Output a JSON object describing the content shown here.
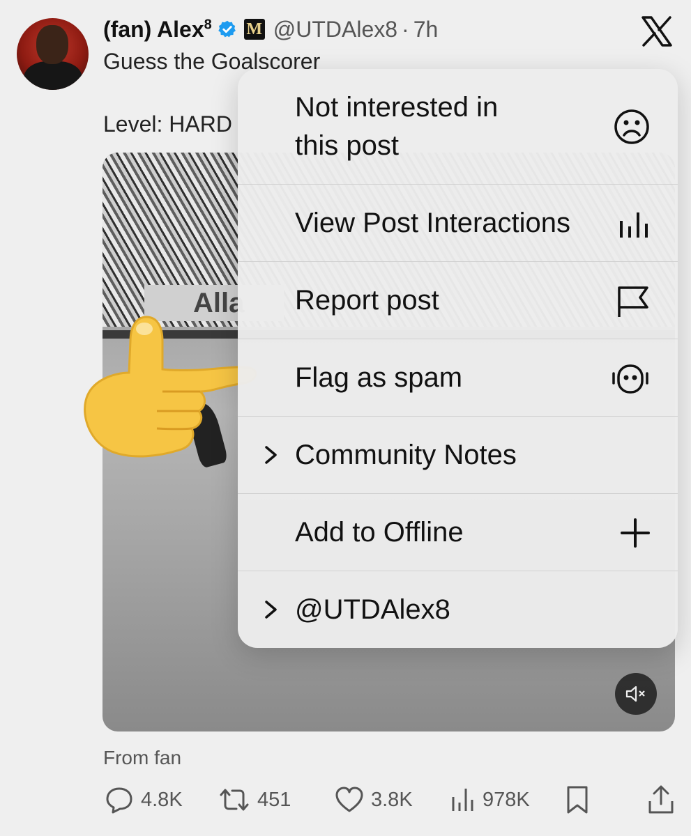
{
  "post": {
    "display_name": "(fan) Alex",
    "name_superscript": "8",
    "badge_letter": "M",
    "handle": "@UTDAlex8",
    "separator": "·",
    "time": "7h",
    "text": "Guess the Goalscorer",
    "level_text": "Level: HARD",
    "board_text": "Alla",
    "from": "From fan"
  },
  "menu": {
    "items": [
      {
        "label_line1": "Not interested in",
        "label_line2": "this post",
        "icon": "sad-face-icon"
      },
      {
        "label": "View Post Interactions",
        "icon": "bar-chart-icon"
      },
      {
        "label": "Report post",
        "icon": "flag-icon"
      },
      {
        "label": "Flag as spam",
        "icon": "robot-icon"
      },
      {
        "label": "Community Notes",
        "icon": "chevron-right-icon"
      },
      {
        "label": "Add to Offline",
        "icon": "plus-icon"
      },
      {
        "label": "@UTDAlex8",
        "icon": "chevron-right-icon"
      }
    ]
  },
  "actions": {
    "replies": "4.8K",
    "reposts": "451",
    "likes": "3.8K",
    "views": "978K"
  },
  "colors": {
    "verified": "#1d9bf0",
    "menu_bg": "#ececec",
    "muted_text": "#555555",
    "emoji_hand": "#f6c544"
  }
}
